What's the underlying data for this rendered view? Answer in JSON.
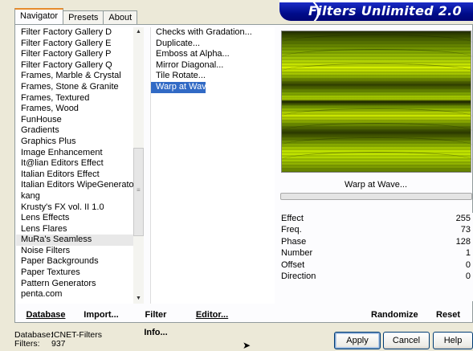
{
  "tabs": [
    {
      "label": "Navigator",
      "active": true
    },
    {
      "label": "Presets",
      "active": false
    },
    {
      "label": "About",
      "active": false
    }
  ],
  "banner": {
    "title": "Filters Unlimited 2.0"
  },
  "categories": [
    "Filter Factory Gallery D",
    "Filter Factory Gallery E",
    "Filter Factory Gallery P",
    "Filter Factory Gallery Q",
    "Frames, Marble & Crystal",
    "Frames, Stone & Granite",
    "Frames, Textured",
    "Frames, Wood",
    "FunHouse",
    "Gradients",
    "Graphics Plus",
    "Image Enhancement",
    "It@lian Editors Effect",
    "Italian Editors Effect",
    "Italian Editors WipeGenerator",
    "kang",
    "Krusty's FX vol. II 1.0",
    "Lens Effects",
    "Lens Flares",
    "MuRa's Seamless",
    "Noise Filters",
    "Paper Backgrounds",
    "Paper Textures",
    "Pattern Generators",
    "penta.com"
  ],
  "selected_category": "MuRa's Seamless",
  "filters": [
    "Checks with Gradation...",
    "Duplicate...",
    "Emboss at Alpha...",
    "Mirror Diagonal...",
    "Tile Rotate...",
    "Warp at Wave..."
  ],
  "selected_filter": "Warp at Wave...",
  "preview_label": "Warp at Wave...",
  "params": [
    {
      "name": "Effect",
      "value": "255"
    },
    {
      "name": "Freq.",
      "value": "73"
    },
    {
      "name": "Phase",
      "value": "128"
    },
    {
      "name": "Number",
      "value": "1"
    },
    {
      "name": "Offset",
      "value": "0"
    },
    {
      "name": "Direction",
      "value": "0"
    }
  ],
  "toolbar": {
    "database": "Database",
    "import": "Import...",
    "filter_info": "Filter Info...",
    "editor": "Editor...",
    "randomize": "Randomize",
    "reset": "Reset"
  },
  "status": {
    "database_label": "Database:",
    "database_value": "ICNET-Filters",
    "filters_label": "Filters:",
    "filters_value": "937"
  },
  "buttons": {
    "apply": "Apply",
    "cancel": "Cancel",
    "help": "Help"
  },
  "colors": {
    "selection": "#316ac5",
    "banner": "#000c8a",
    "preview_accent": "#b7dc00"
  }
}
